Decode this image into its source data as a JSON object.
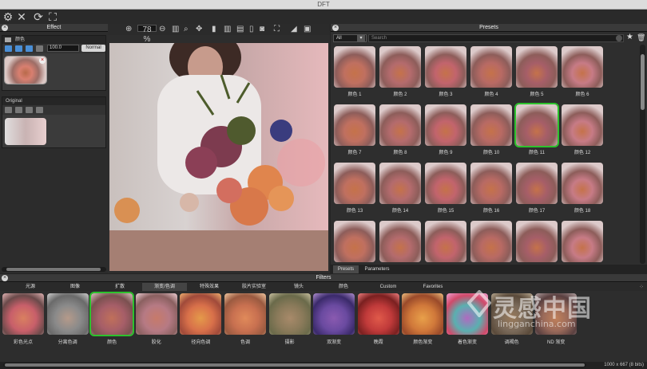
{
  "window": {
    "title": "DFT"
  },
  "toolbar": {
    "icons": [
      "gear-icon",
      "close-icon",
      "refresh-icon",
      "fit-icon"
    ]
  },
  "effect_panel": {
    "title": "Effect",
    "layer_name": "颜色",
    "opacity_value": "100.0",
    "blend_mode": "Normal",
    "original_title": "Original"
  },
  "viewer": {
    "zoom": "78 %"
  },
  "presets_panel": {
    "title": "Presets",
    "category": "All",
    "search_placeholder": "Search",
    "items": [
      {
        "label": "颜色 1"
      },
      {
        "label": "颜色 2"
      },
      {
        "label": "颜色 3"
      },
      {
        "label": "颜色 4"
      },
      {
        "label": "颜色 5"
      },
      {
        "label": "颜色 6"
      },
      {
        "label": "颜色 7"
      },
      {
        "label": "颜色 8"
      },
      {
        "label": "颜色 9"
      },
      {
        "label": "颜色 10"
      },
      {
        "label": "颜色 11"
      },
      {
        "label": "颜色 12"
      },
      {
        "label": "颜色 13"
      },
      {
        "label": "颜色 14"
      },
      {
        "label": "颜色 15"
      },
      {
        "label": "颜色 16"
      },
      {
        "label": "颜色 17"
      },
      {
        "label": "颜色 18"
      },
      {
        "label": ""
      },
      {
        "label": ""
      },
      {
        "label": ""
      },
      {
        "label": ""
      },
      {
        "label": ""
      },
      {
        "label": ""
      }
    ],
    "selected_index": 10,
    "tabs": [
      "Presets",
      "Parameters"
    ]
  },
  "filters_panel": {
    "title": "Filters",
    "categories": [
      "光源",
      "图像",
      "扩散",
      "渐变/色调",
      "特殊效果",
      "胶片实验室",
      "镜头",
      "颜色",
      "Custom",
      "Favorites"
    ],
    "active_category": 3,
    "items": [
      "彩色光点",
      "分离色调",
      "颜色",
      "胶化",
      "径向色调",
      "色调",
      "摄影",
      "双渐变",
      "晚霞",
      "颜色渐变",
      "着色渐变",
      "调褐色",
      "ND 渐变"
    ],
    "selected_index": 2
  },
  "status": {
    "image_info": "1000 x 667 (8 bits)"
  },
  "watermark": {
    "text": "灵感中国",
    "url": "lingganchina.com"
  }
}
